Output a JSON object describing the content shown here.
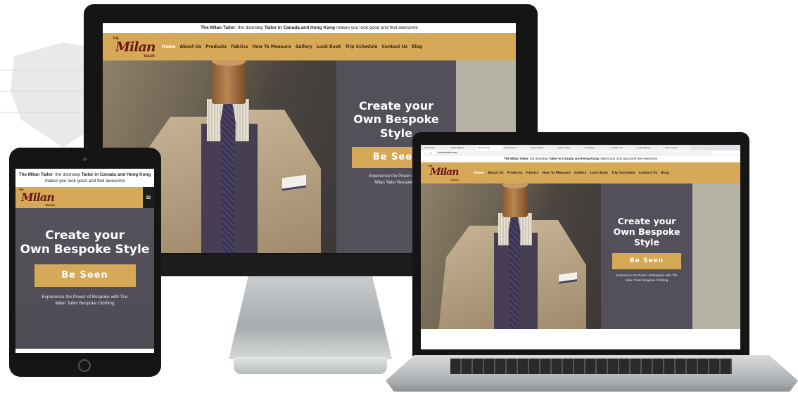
{
  "site": {
    "topbar_brand": "The Milan Tailor",
    "topbar_mid": ": the doorstep ",
    "topbar_location": "Tailor in Canada and Hong Kong",
    "topbar_end": " makes you look good and feel awesome",
    "logo_the": "THE",
    "logo_name": "Milan",
    "logo_tailor": "TAILOR",
    "nav": [
      {
        "label": "Home"
      },
      {
        "label": "About Us"
      },
      {
        "label": "Products"
      },
      {
        "label": "Fabrics"
      },
      {
        "label": "How To Measure"
      },
      {
        "label": "Gallery"
      },
      {
        "label": "Look Book"
      },
      {
        "label": "Trip Schedule"
      },
      {
        "label": "Contact Us"
      },
      {
        "label": "Blog"
      }
    ],
    "hero_heading_line1": "Create your",
    "hero_heading_line2": "Own Bespoke",
    "hero_heading_line3": "Style",
    "hero_heading_tablet_line1": "Create your",
    "hero_heading_tablet_line2": "Own Bespoke Style",
    "cta_label": "Be Seen",
    "hero_sub_line1": "Experience the Power of Bespoke with The",
    "hero_sub_line2": "Milan Tailor Bespoke Clothing",
    "imac_sub_line1": "Experience the Power of Bes",
    "imac_sub_line2": "Milan Tailor Bespoke C",
    "imac_cta": "Be Seen",
    "hamburger": "≡"
  },
  "browser": {
    "tabs": [
      "Morrelanen",
      "(147) WhatsA",
      "Bespoke Tail",
      "Rene Interim",
      "Team Standu",
      "Inbox (1371)",
      "Top Mattre",
      "website mor",
      "Free Website",
      "The Conston"
    ],
    "url": "themilantailor.com",
    "nav_arrows": "← → C"
  },
  "colors": {
    "accent": "#d6a959",
    "panel": "#54505a",
    "logo": "#6b1a12"
  }
}
